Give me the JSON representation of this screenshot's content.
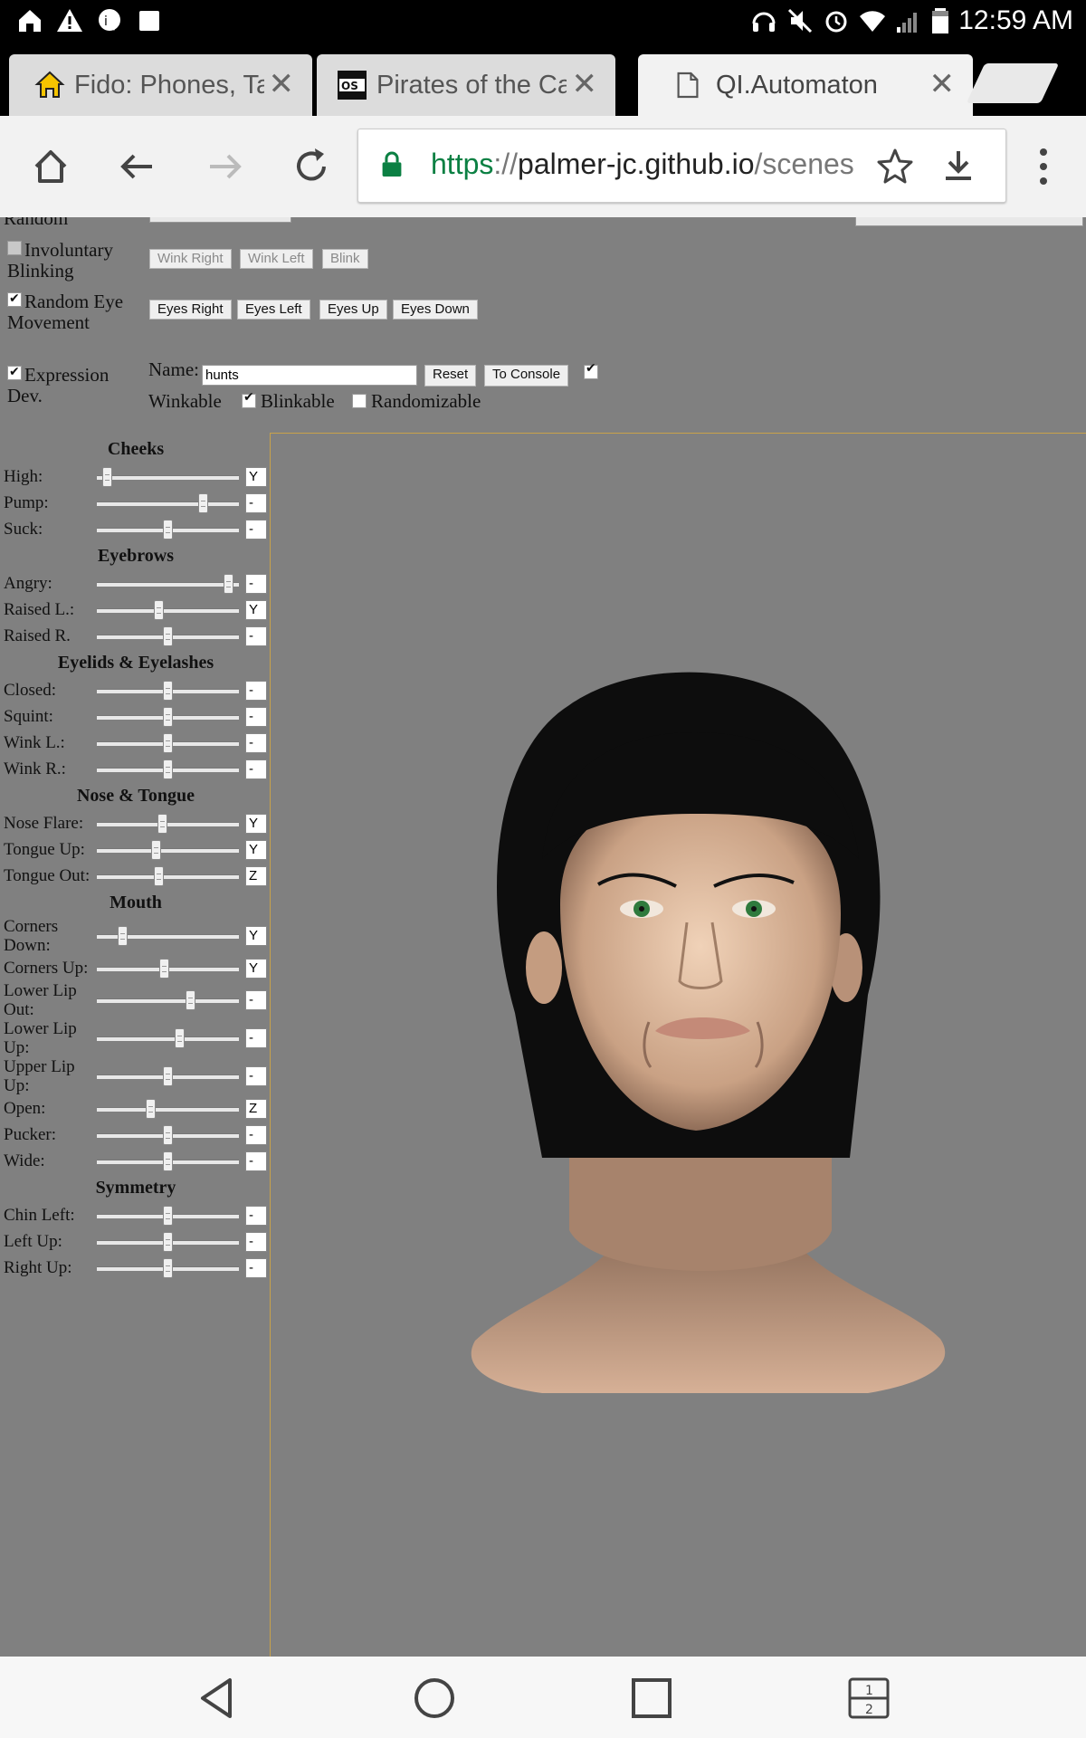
{
  "status": {
    "time": "12:59 AM"
  },
  "tabs": [
    {
      "title": "Fido: Phones, Ta",
      "active": false
    },
    {
      "title": "Pirates of the Ca",
      "active": false
    },
    {
      "title": "QI.Automaton",
      "active": true
    }
  ],
  "omnibox": {
    "scheme": "https",
    "sep": "://",
    "host": "palmer-jc.github.io",
    "path": "/scenes"
  },
  "controls": {
    "random_label": "Random",
    "involuntary_blinking": {
      "label_line1": "Involuntary",
      "label_line2": "Blinking",
      "checked": false
    },
    "blink_buttons": [
      "Wink Right",
      "Wink Left",
      "Blink"
    ],
    "random_eye": {
      "label_line1": "Random Eye",
      "label_line2": "Movement",
      "checked": true
    },
    "eye_buttons": [
      "Eyes Right",
      "Eyes Left",
      "Eyes Up",
      "Eyes Down"
    ],
    "expression_dev": {
      "label_line1": "Expression",
      "label_line2": "Dev.",
      "checked": true
    },
    "name_label": "Name:",
    "name_value": "hunts",
    "reset_label": "Reset",
    "console_label": "To Console",
    "winkable_label": "Winkable",
    "blinkable_label": "Blinkable",
    "randomizable_label": "Randomizable",
    "winkable_checked": true,
    "blinkable_checked": true,
    "randomizable_checked": false
  },
  "sections": [
    {
      "title": "Cheeks",
      "sliders": [
        {
          "label": "High:",
          "value": 0.04,
          "box": "Y"
        },
        {
          "label": "Pump:",
          "value": 0.77,
          "box": "-"
        },
        {
          "label": "Suck:",
          "value": 0.5,
          "box": "-"
        }
      ]
    },
    {
      "title": "Eyebrows",
      "sliders": [
        {
          "label": "Angry:",
          "value": 0.96,
          "box": "-"
        },
        {
          "label": "Raised L.:",
          "value": 0.43,
          "box": "Y"
        },
        {
          "label": "Raised R.",
          "value": 0.5,
          "box": "-"
        }
      ]
    },
    {
      "title": "Eyelids & Eyelashes",
      "sliders": [
        {
          "label": "Closed:",
          "value": 0.5,
          "box": "-"
        },
        {
          "label": "Squint:",
          "value": 0.5,
          "box": "-"
        },
        {
          "label": "Wink L.:",
          "value": 0.5,
          "box": "-"
        },
        {
          "label": "Wink R.:",
          "value": 0.5,
          "box": "-"
        }
      ]
    },
    {
      "title": "Nose & Tongue",
      "sliders": [
        {
          "label": "Nose Flare:",
          "value": 0.46,
          "box": "Y"
        },
        {
          "label": "Tongue Up:",
          "value": 0.41,
          "box": "Y"
        },
        {
          "label": "Tongue Out:",
          "value": 0.43,
          "box": "Z"
        }
      ]
    },
    {
      "title": "Mouth",
      "sliders": [
        {
          "label": "Corners Down:",
          "value": 0.16,
          "box": "Y"
        },
        {
          "label": "Corners Up:",
          "value": 0.47,
          "box": "Y"
        },
        {
          "label": "Lower Lip Out:",
          "value": 0.67,
          "box": "-"
        },
        {
          "label": "Lower Lip Up:",
          "value": 0.59,
          "box": "-"
        },
        {
          "label": "Upper Lip Up:",
          "value": 0.5,
          "box": "-"
        },
        {
          "label": "Open:",
          "value": 0.37,
          "box": "Z"
        },
        {
          "label": "Pucker:",
          "value": 0.5,
          "box": "-"
        },
        {
          "label": "Wide:",
          "value": 0.5,
          "box": "-"
        }
      ]
    },
    {
      "title": "Symmetry",
      "sliders": [
        {
          "label": "Chin Left:",
          "value": 0.5,
          "box": "-"
        },
        {
          "label": "Left Up:",
          "value": 0.5,
          "box": "-"
        },
        {
          "label": "Right Up:",
          "value": 0.5,
          "box": "-"
        }
      ]
    }
  ]
}
